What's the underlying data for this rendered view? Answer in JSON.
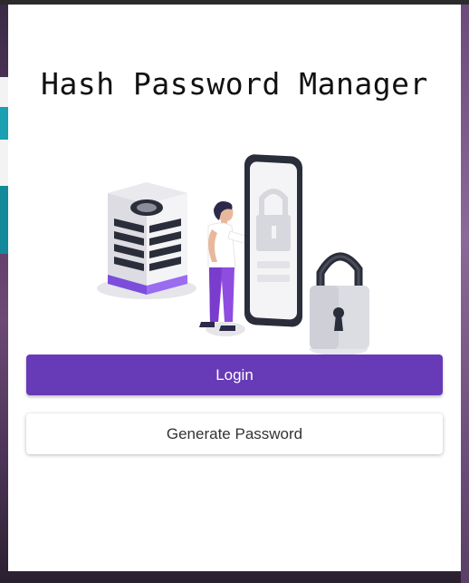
{
  "app": {
    "title": "Hash Password Manager"
  },
  "actions": {
    "login_label": "Login",
    "generate_label": "Generate Password"
  },
  "colors": {
    "accent": "#673ab7",
    "background": "#ffffff"
  },
  "icons": [
    "server-illustration",
    "person-illustration",
    "phone-lock-illustration",
    "padlock-icon"
  ]
}
